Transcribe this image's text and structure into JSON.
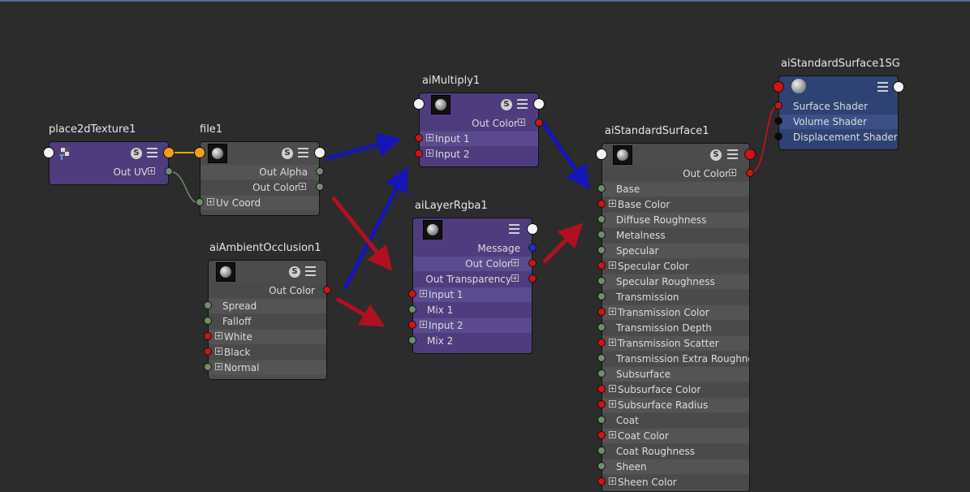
{
  "accent_colors": {
    "gray_node": "#4c4c4c",
    "purple_node": "#4e3c7e",
    "sg_node": "#2f4274",
    "background": "#2c2c2c"
  },
  "nodes": {
    "place2d": {
      "title": "place2dTexture1",
      "s_label": "S",
      "ports": [
        "Out UV"
      ]
    },
    "file": {
      "title": "file1",
      "s_label": "S",
      "ports": [
        "Out Alpha",
        "Out Color",
        "Uv Coord"
      ]
    },
    "ao": {
      "title": "aiAmbientOcclusion1",
      "s_label": "S",
      "ports": [
        "Out Color",
        "Spread",
        "Falloff",
        "White",
        "Black",
        "Normal"
      ]
    },
    "multiply": {
      "title": "aiMultiply1",
      "s_label": "S",
      "ports": [
        "Out Color",
        "Input 1",
        "Input 2"
      ]
    },
    "layer": {
      "title": "aiLayerRgba1",
      "ports": [
        "Message",
        "Out Color",
        "Out Transparency",
        "Input 1",
        "Mix 1",
        "Input 2",
        "Mix 2"
      ]
    },
    "surface": {
      "title": "aiStandardSurface1",
      "s_label": "S",
      "ports": [
        "Out Color",
        "Base",
        "Base Color",
        "Diffuse Roughness",
        "Metalness",
        "Specular",
        "Specular Color",
        "Specular Roughness",
        "Transmission",
        "Transmission Color",
        "Transmission Depth",
        "Transmission Scatter",
        "Transmission Extra Roughness",
        "Subsurface",
        "Subsurface Color",
        "Subsurface Radius",
        "Coat",
        "Coat Color",
        "Coat Roughness",
        "Sheen",
        "Sheen Color"
      ]
    },
    "sg": {
      "title": "aiStandardSurface1SG",
      "ports": [
        "Surface Shader",
        "Volume Shader",
        "Displacement Shader"
      ]
    }
  }
}
